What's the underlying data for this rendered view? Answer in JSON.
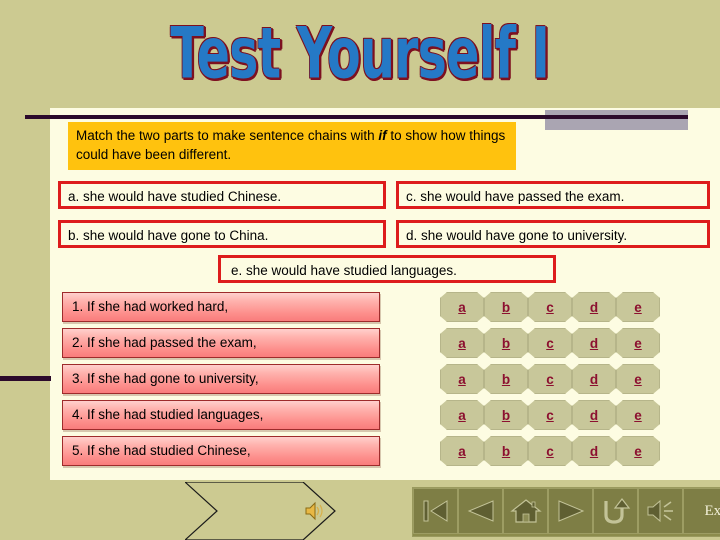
{
  "slide": {
    "title": "Test Yourself I",
    "title_colors": {
      "fill": "#2579c6",
      "shadow": "#7d1020"
    },
    "background_color": "#ccca91",
    "panel_color": "#fdfce2"
  },
  "instruction": {
    "text_before_if": "Match the two parts to make sentence chains with ",
    "emphasis": "if",
    "text_after_if": " to show how things could have been different.",
    "background_color": "#ffc20e"
  },
  "options": [
    {
      "id": "a",
      "label": "a. she would have studied Chinese."
    },
    {
      "id": "b",
      "label": "b. she would have gone to China."
    },
    {
      "id": "c",
      "label": "c. she would have passed the exam."
    },
    {
      "id": "d",
      "label": "d. she would have gone to university."
    },
    {
      "id": "e",
      "label": "e. she would have studied languages."
    }
  ],
  "option_border_color": "#dd1c1c",
  "questions": [
    {
      "number": "1",
      "label": "1. If she had worked hard,"
    },
    {
      "number": "2",
      "label": "2. If she had passed the exam,"
    },
    {
      "number": "3",
      "label": "3. If she had gone to university,"
    },
    {
      "number": "4",
      "label": "4. If she had studied languages,"
    },
    {
      "number": "5",
      "label": "5. If she had studied Chinese,"
    }
  ],
  "answer_grid": {
    "link_color": "#8c1030",
    "rows": [
      {
        "row": "1",
        "choices": [
          "a",
          "b",
          "c",
          "d",
          "e"
        ]
      },
      {
        "row": "2",
        "choices": [
          "a",
          "b",
          "c",
          "d",
          "e"
        ]
      },
      {
        "row": "3",
        "choices": [
          "a",
          "b",
          "c",
          "d",
          "e"
        ]
      },
      {
        "row": "4",
        "choices": [
          "a",
          "b",
          "c",
          "d",
          "e"
        ]
      },
      {
        "row": "5",
        "choices": [
          "a",
          "b",
          "c",
          "d",
          "e"
        ]
      }
    ]
  },
  "navbar": {
    "buttons": [
      {
        "name": "first-slide",
        "icon": "first-icon"
      },
      {
        "name": "previous-slide",
        "icon": "previous-icon"
      },
      {
        "name": "home-slide",
        "icon": "home-icon"
      },
      {
        "name": "next-slide",
        "icon": "next-icon"
      },
      {
        "name": "return-slide",
        "icon": "return-arrow-icon"
      },
      {
        "name": "sound-toggle",
        "icon": "speaker-icon"
      }
    ],
    "exit_label": "Exit"
  }
}
